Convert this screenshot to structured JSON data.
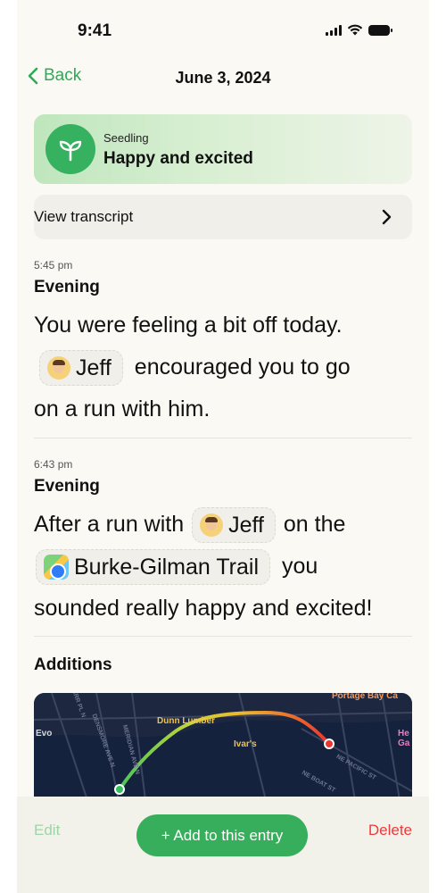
{
  "status_bar": {
    "time": "9:41"
  },
  "nav": {
    "back_label": "Back",
    "title": "June 3, 2024"
  },
  "mood": {
    "category": "Seedling",
    "title": "Happy and excited",
    "icon": "sprout-icon"
  },
  "transcript": {
    "label": "View transcript"
  },
  "entries": [
    {
      "time": "5:45 pm",
      "period": "Evening",
      "text_part1": "You were feeling a bit off today.",
      "person": "Jeff",
      "text_part2": "encouraged you to go",
      "text_part3": "on a run with him."
    },
    {
      "time": "6:43 pm",
      "period": "Evening",
      "text_part1": "After a run with",
      "person": "Jeff",
      "text_part2": "on the",
      "place": "Burke-Gilman Trail",
      "text_part3": "you",
      "text_part4": "sounded really happy and excited!"
    }
  ],
  "additions": {
    "title": "Additions",
    "map_labels": {
      "portage_bay": "Portage Bay Ca",
      "dunn_lumber": "Dunn Lumber",
      "ivars": "Ivar's",
      "evo": "Evo",
      "he_ga": "He\nGa",
      "carr_place": "CARR PL N",
      "densmore": "DENSMORE AVE N",
      "meridian": "MERIDIAN AVE N",
      "pacific": "NE PACIFIC ST",
      "boat_st": "NE BOAT ST"
    }
  },
  "bottom_bar": {
    "edit": "Edit",
    "add": "+ Add to this entry",
    "delete": "Delete"
  },
  "colors": {
    "accent_green": "#36ae5c",
    "delete_red": "#ee3a3a",
    "background": "#fbf9f3"
  }
}
